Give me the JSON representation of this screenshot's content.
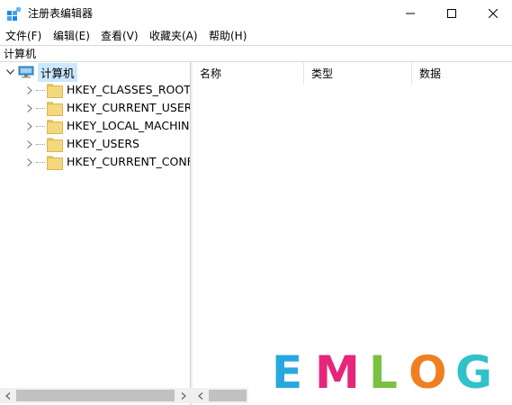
{
  "window": {
    "title": "注册表编辑器"
  },
  "menubar": {
    "items": [
      {
        "label": "文件(F)"
      },
      {
        "label": "编辑(E)"
      },
      {
        "label": "查看(V)"
      },
      {
        "label": "收藏夹(A)"
      },
      {
        "label": "帮助(H)"
      }
    ]
  },
  "address": {
    "path": "计算机"
  },
  "tree": {
    "root": {
      "label": "计算机",
      "icon": "computer-icon",
      "expanded": true,
      "selected": true
    },
    "keys": [
      {
        "label": "HKEY_CLASSES_ROOT",
        "icon": "folder-icon"
      },
      {
        "label": "HKEY_CURRENT_USER",
        "icon": "folder-icon"
      },
      {
        "label": "HKEY_LOCAL_MACHINE",
        "icon": "folder-icon"
      },
      {
        "label": "HKEY_USERS",
        "icon": "folder-icon"
      },
      {
        "label": "HKEY_CURRENT_CONFIG",
        "icon": "folder-icon"
      }
    ]
  },
  "list": {
    "columns": [
      {
        "label": "名称"
      },
      {
        "label": "类型"
      },
      {
        "label": "数据"
      }
    ]
  },
  "watermark": {
    "letters": [
      {
        "char": "E",
        "color": "#29a8e0"
      },
      {
        "char": "M",
        "color": "#e5267a"
      },
      {
        "char": "L",
        "color": "#7ac143"
      },
      {
        "char": "O",
        "color": "#f07f22"
      },
      {
        "char": "G",
        "color": "#2fc2c9"
      }
    ]
  },
  "colors": {
    "selection": "#cce8ff",
    "folder": "#f5d77d",
    "scrollbar": "#f0f0f0",
    "scroll_thumb": "#c1c1c1"
  }
}
